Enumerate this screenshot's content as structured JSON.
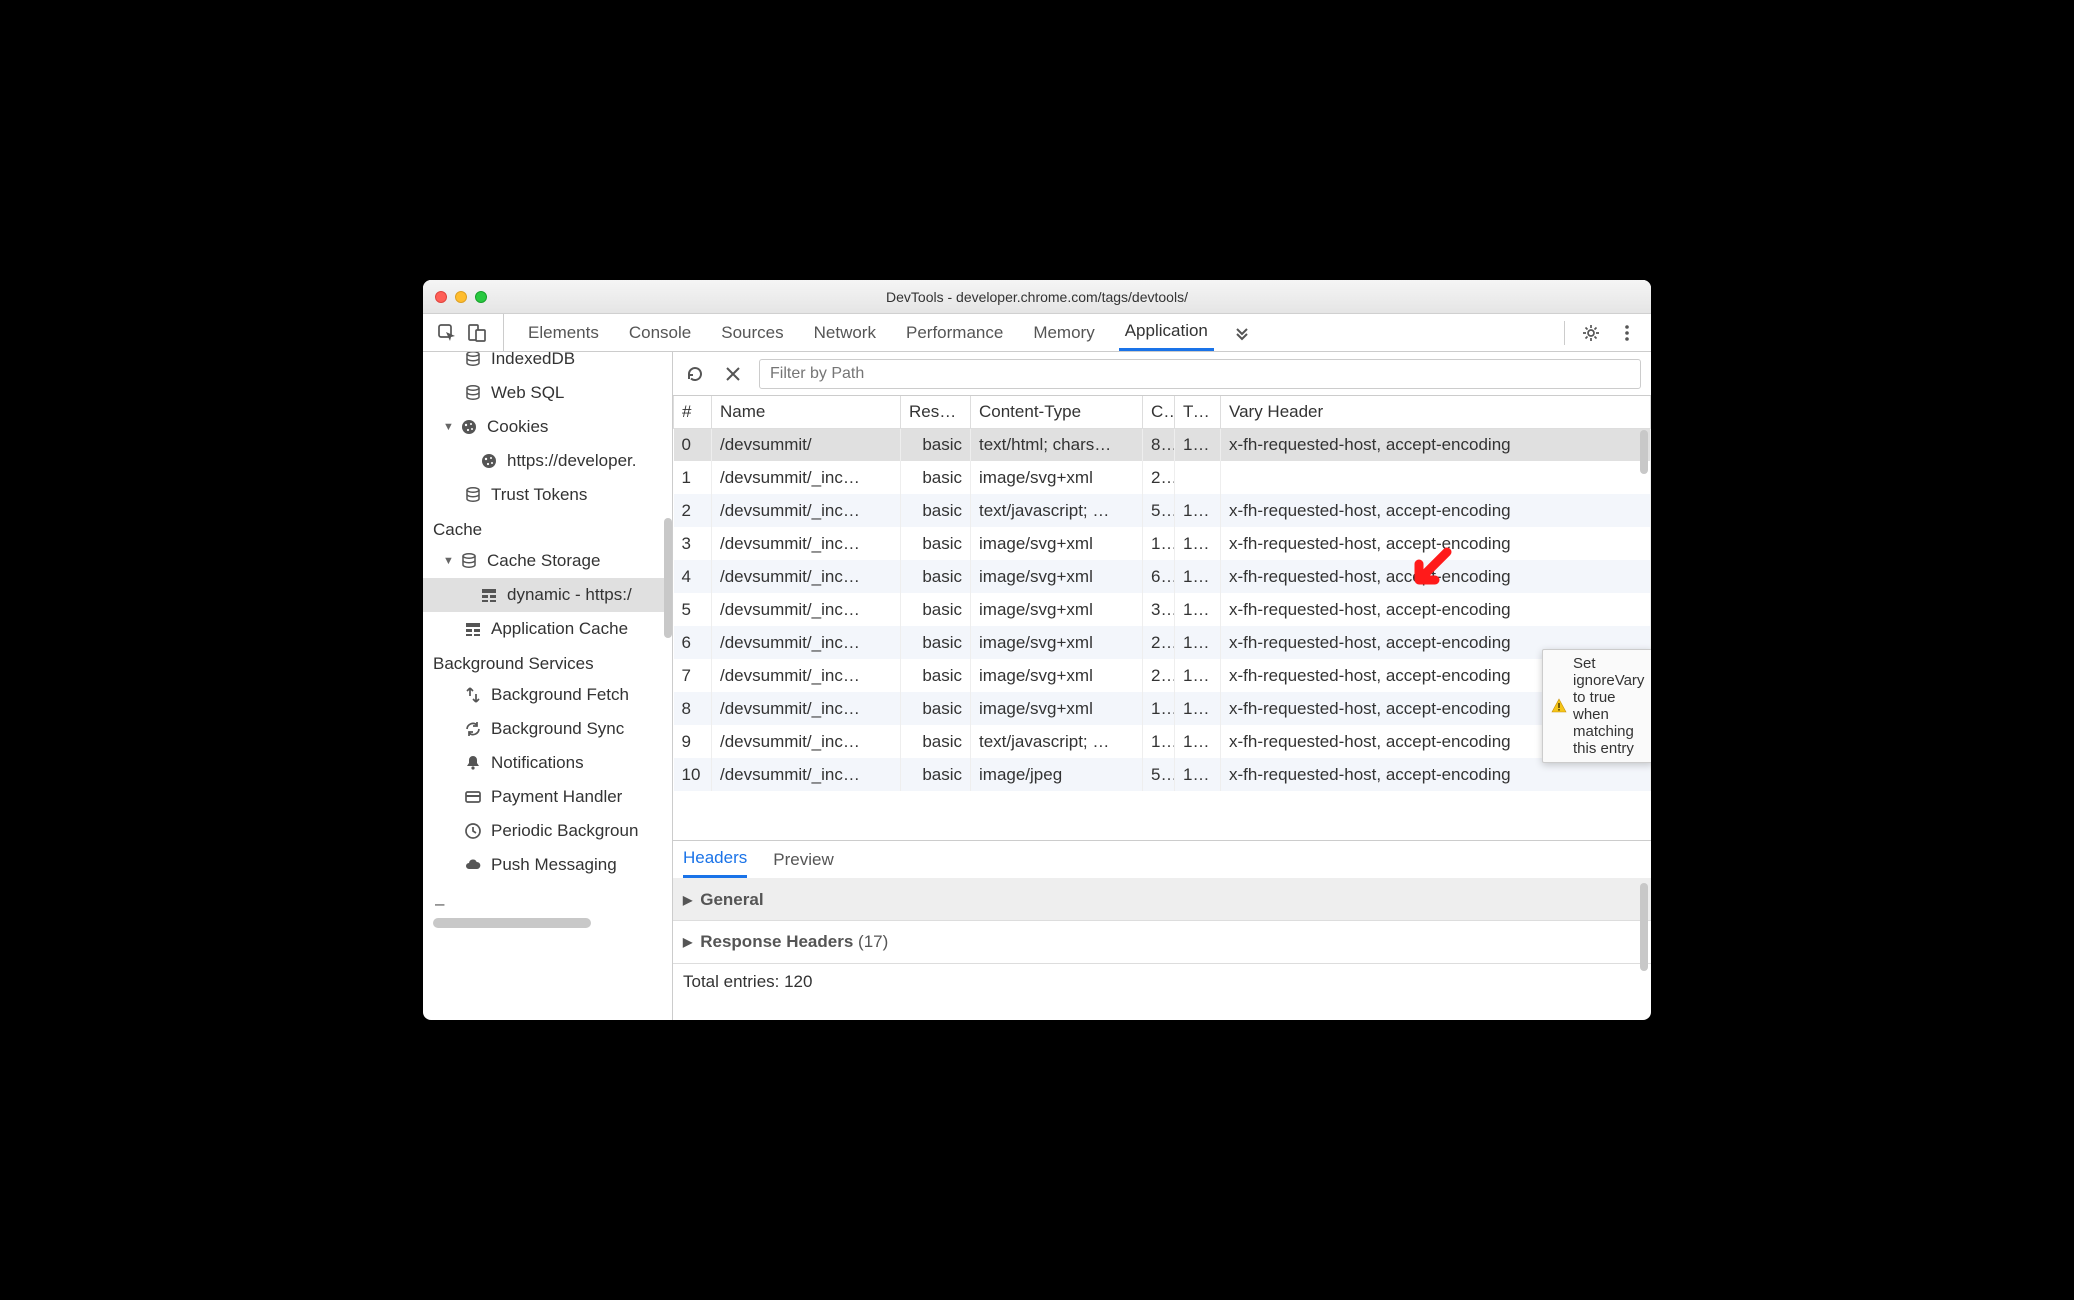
{
  "window": {
    "title": "DevTools - developer.chrome.com/tags/devtools/"
  },
  "tabs": {
    "items": [
      "Elements",
      "Console",
      "Sources",
      "Network",
      "Performance",
      "Memory",
      "Application"
    ],
    "active": "Application"
  },
  "sidebar": {
    "indexeddb": "IndexedDB",
    "websql": "Web SQL",
    "cookies": "Cookies",
    "cookies_item": "https://developer.",
    "trusttokens": "Trust Tokens",
    "cache_section": "Cache",
    "cachestorage": "Cache Storage",
    "cachestorage_item": "dynamic - https:/",
    "appcache": "Application Cache",
    "bg_section": "Background Services",
    "bgfetch": "Background Fetch",
    "bgsync": "Background Sync",
    "notifications": "Notifications",
    "payhandler": "Payment Handler",
    "periodic": "Periodic Backgroun",
    "push": "Push Messaging"
  },
  "toolbar": {
    "filter_placeholder": "Filter by Path"
  },
  "table": {
    "headers": {
      "num": "#",
      "name": "Name",
      "response": "Res…",
      "type": "Content-Type",
      "c": "C..",
      "t": "Ti…",
      "vary": "Vary Header"
    },
    "rows": [
      {
        "num": "0",
        "name": "/devsummit/",
        "res": "basic",
        "type": "text/html; chars…",
        "c": "8…",
        "t": "1…",
        "vary": "x-fh-requested-host, accept-encoding"
      },
      {
        "num": "1",
        "name": "/devsummit/_inc…",
        "res": "basic",
        "type": "image/svg+xml",
        "c": "2…",
        "t": "",
        "vary": ""
      },
      {
        "num": "2",
        "name": "/devsummit/_inc…",
        "res": "basic",
        "type": "text/javascript; …",
        "c": "5…",
        "t": "1…",
        "vary": "x-fh-requested-host, accept-encoding"
      },
      {
        "num": "3",
        "name": "/devsummit/_inc…",
        "res": "basic",
        "type": "image/svg+xml",
        "c": "1…",
        "t": "1…",
        "vary": "x-fh-requested-host, accept-encoding"
      },
      {
        "num": "4",
        "name": "/devsummit/_inc…",
        "res": "basic",
        "type": "image/svg+xml",
        "c": "6…",
        "t": "1…",
        "vary": "x-fh-requested-host, accept-encoding"
      },
      {
        "num": "5",
        "name": "/devsummit/_inc…",
        "res": "basic",
        "type": "image/svg+xml",
        "c": "3…",
        "t": "1…",
        "vary": "x-fh-requested-host, accept-encoding"
      },
      {
        "num": "6",
        "name": "/devsummit/_inc…",
        "res": "basic",
        "type": "image/svg+xml",
        "c": "2…",
        "t": "1…",
        "vary": "x-fh-requested-host, accept-encoding"
      },
      {
        "num": "7",
        "name": "/devsummit/_inc…",
        "res": "basic",
        "type": "image/svg+xml",
        "c": "2…",
        "t": "1…",
        "vary": "x-fh-requested-host, accept-encoding"
      },
      {
        "num": "8",
        "name": "/devsummit/_inc…",
        "res": "basic",
        "type": "image/svg+xml",
        "c": "1…",
        "t": "1…",
        "vary": "x-fh-requested-host, accept-encoding"
      },
      {
        "num": "9",
        "name": "/devsummit/_inc…",
        "res": "basic",
        "type": "text/javascript; …",
        "c": "1…",
        "t": "1…",
        "vary": "x-fh-requested-host, accept-encoding"
      },
      {
        "num": "10",
        "name": "/devsummit/_inc…",
        "res": "basic",
        "type": "image/jpeg",
        "c": "5…",
        "t": "1…",
        "vary": "x-fh-requested-host, accept-encoding"
      }
    ]
  },
  "tooltip": "Set ignoreVary to true when matching this entry",
  "details": {
    "tabs": [
      "Headers",
      "Preview"
    ],
    "active": "Headers",
    "general": "General",
    "respheaders": "Response Headers",
    "respcount": "(17)",
    "total": "Total entries: 120"
  }
}
